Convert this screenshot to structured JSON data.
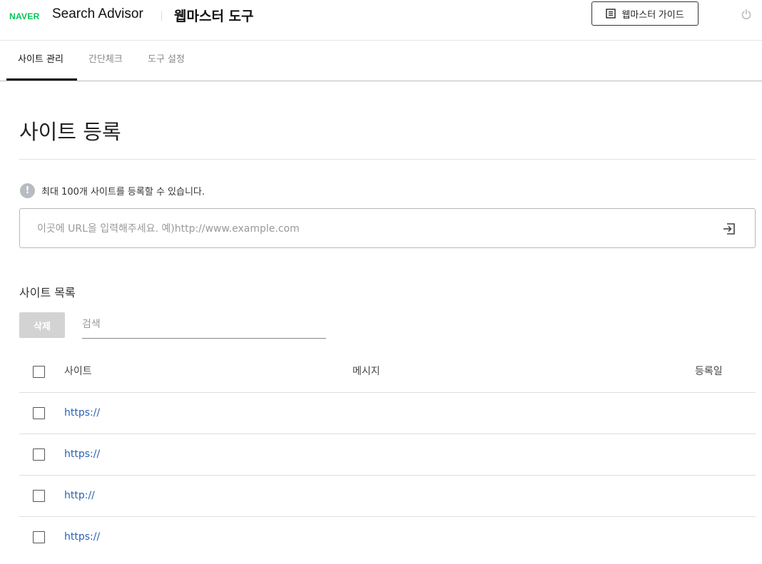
{
  "header": {
    "logo": "NAVER",
    "app_name": "Search Advisor",
    "tool_title": "웹마스터 도구",
    "guide_button": "웹마스터 가이드"
  },
  "tabs": [
    {
      "label": "사이트 관리",
      "active": true
    },
    {
      "label": "간단체크",
      "active": false
    },
    {
      "label": "도구 설정",
      "active": false
    }
  ],
  "page": {
    "title": "사이트 등록",
    "notice": "최대 100개 사이트를 등록할 수 있습니다.",
    "url_placeholder": "이곳에 URL을 입력해주세요. 예)http://www.example.com"
  },
  "site_list": {
    "title": "사이트 목록",
    "delete_button": "삭제",
    "search_placeholder": "검색",
    "columns": [
      "사이트",
      "메시지",
      "등록일"
    ],
    "rows": [
      {
        "site": "https://"
      },
      {
        "site": "https://"
      },
      {
        "site": "http://"
      },
      {
        "site": "https://"
      }
    ]
  },
  "colors": {
    "brand": "#03c75a",
    "link": "#2a62b4",
    "disabled_button": "#d3d3d3"
  }
}
